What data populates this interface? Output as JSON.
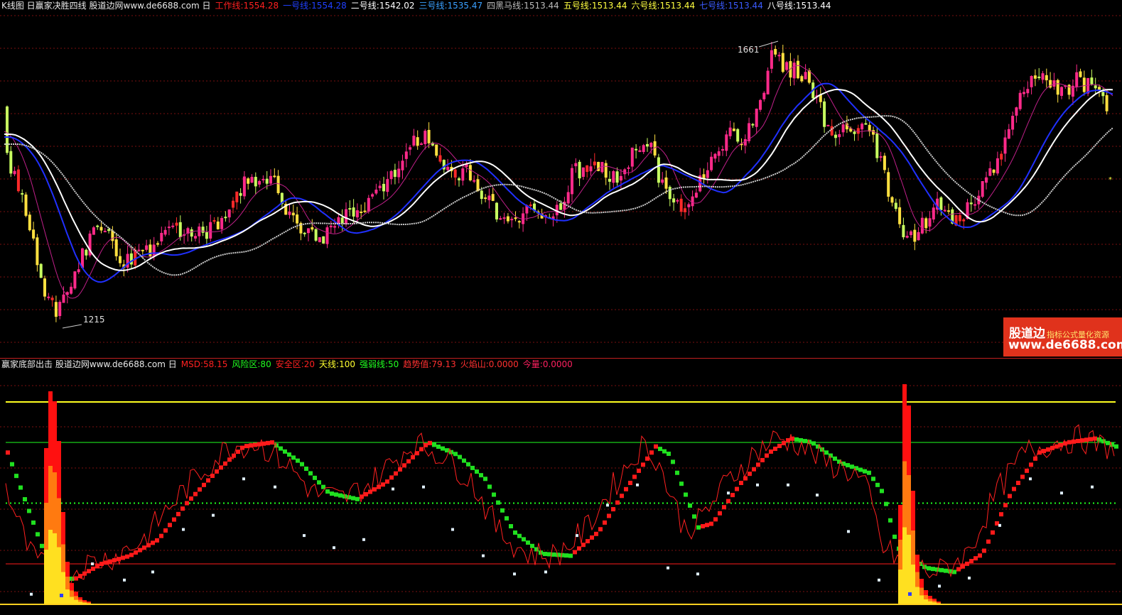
{
  "main_panel": {
    "title": "K线图 日赢家决胜四线 股道边网www.de6688.com 日",
    "indicators": [
      {
        "label": "工作线:1554.28",
        "color": "#ff2020"
      },
      {
        "label": "一号线:1554.28",
        "color": "#2040ff"
      },
      {
        "label": "二号线:1542.02",
        "color": "#ffffff"
      },
      {
        "label": "三号线:1535.47",
        "color": "#3aa0ff"
      },
      {
        "label": "四黑马线:1513.44",
        "color": "#bbbbbb"
      },
      {
        "label": "五号线:1513.44",
        "color": "#ffff40"
      },
      {
        "label": "六号线:1513.44",
        "color": "#ffff40"
      },
      {
        "label": "七号线:1513.44",
        "color": "#3a5bff"
      },
      {
        "label": "八号线:1513.44",
        "color": "#ffffff"
      }
    ],
    "high_label": "1661",
    "low_label": "1215"
  },
  "sub_panel": {
    "title": "赢家底部出击 股道边网www.de6688.com 日",
    "indicators": [
      {
        "label": "MSD:58.15",
        "color": "#ff2020"
      },
      {
        "label": "风险区:80",
        "color": "#20ff20"
      },
      {
        "label": "安全区:20",
        "color": "#ff2020"
      },
      {
        "label": "天线:100",
        "color": "#ffff30"
      },
      {
        "label": "强弱线:50",
        "color": "#20ff20"
      },
      {
        "label": "趋势值:79.13",
        "color": "#ff3030"
      },
      {
        "label": "火焰山:0.0000",
        "color": "#ff3030"
      },
      {
        "label": "今量:0.0000",
        "color": "#ff2060"
      }
    ],
    "levels": {
      "sky": 100,
      "risk": 80,
      "mid": 50,
      "safe": 20
    }
  },
  "watermark": {
    "title": "股道边",
    "subtitle": "指标公式量化资源",
    "url": "www.de6688.com"
  },
  "colors": {
    "up_candle": "#ff2a8a",
    "down_candle": "#ffe040",
    "bear_candle": "#c8ff60",
    "red_line": "#ff1a1a",
    "green_line": "#20ff20",
    "yellow_line": "#ffff20",
    "grid": "#7a1010"
  }
}
